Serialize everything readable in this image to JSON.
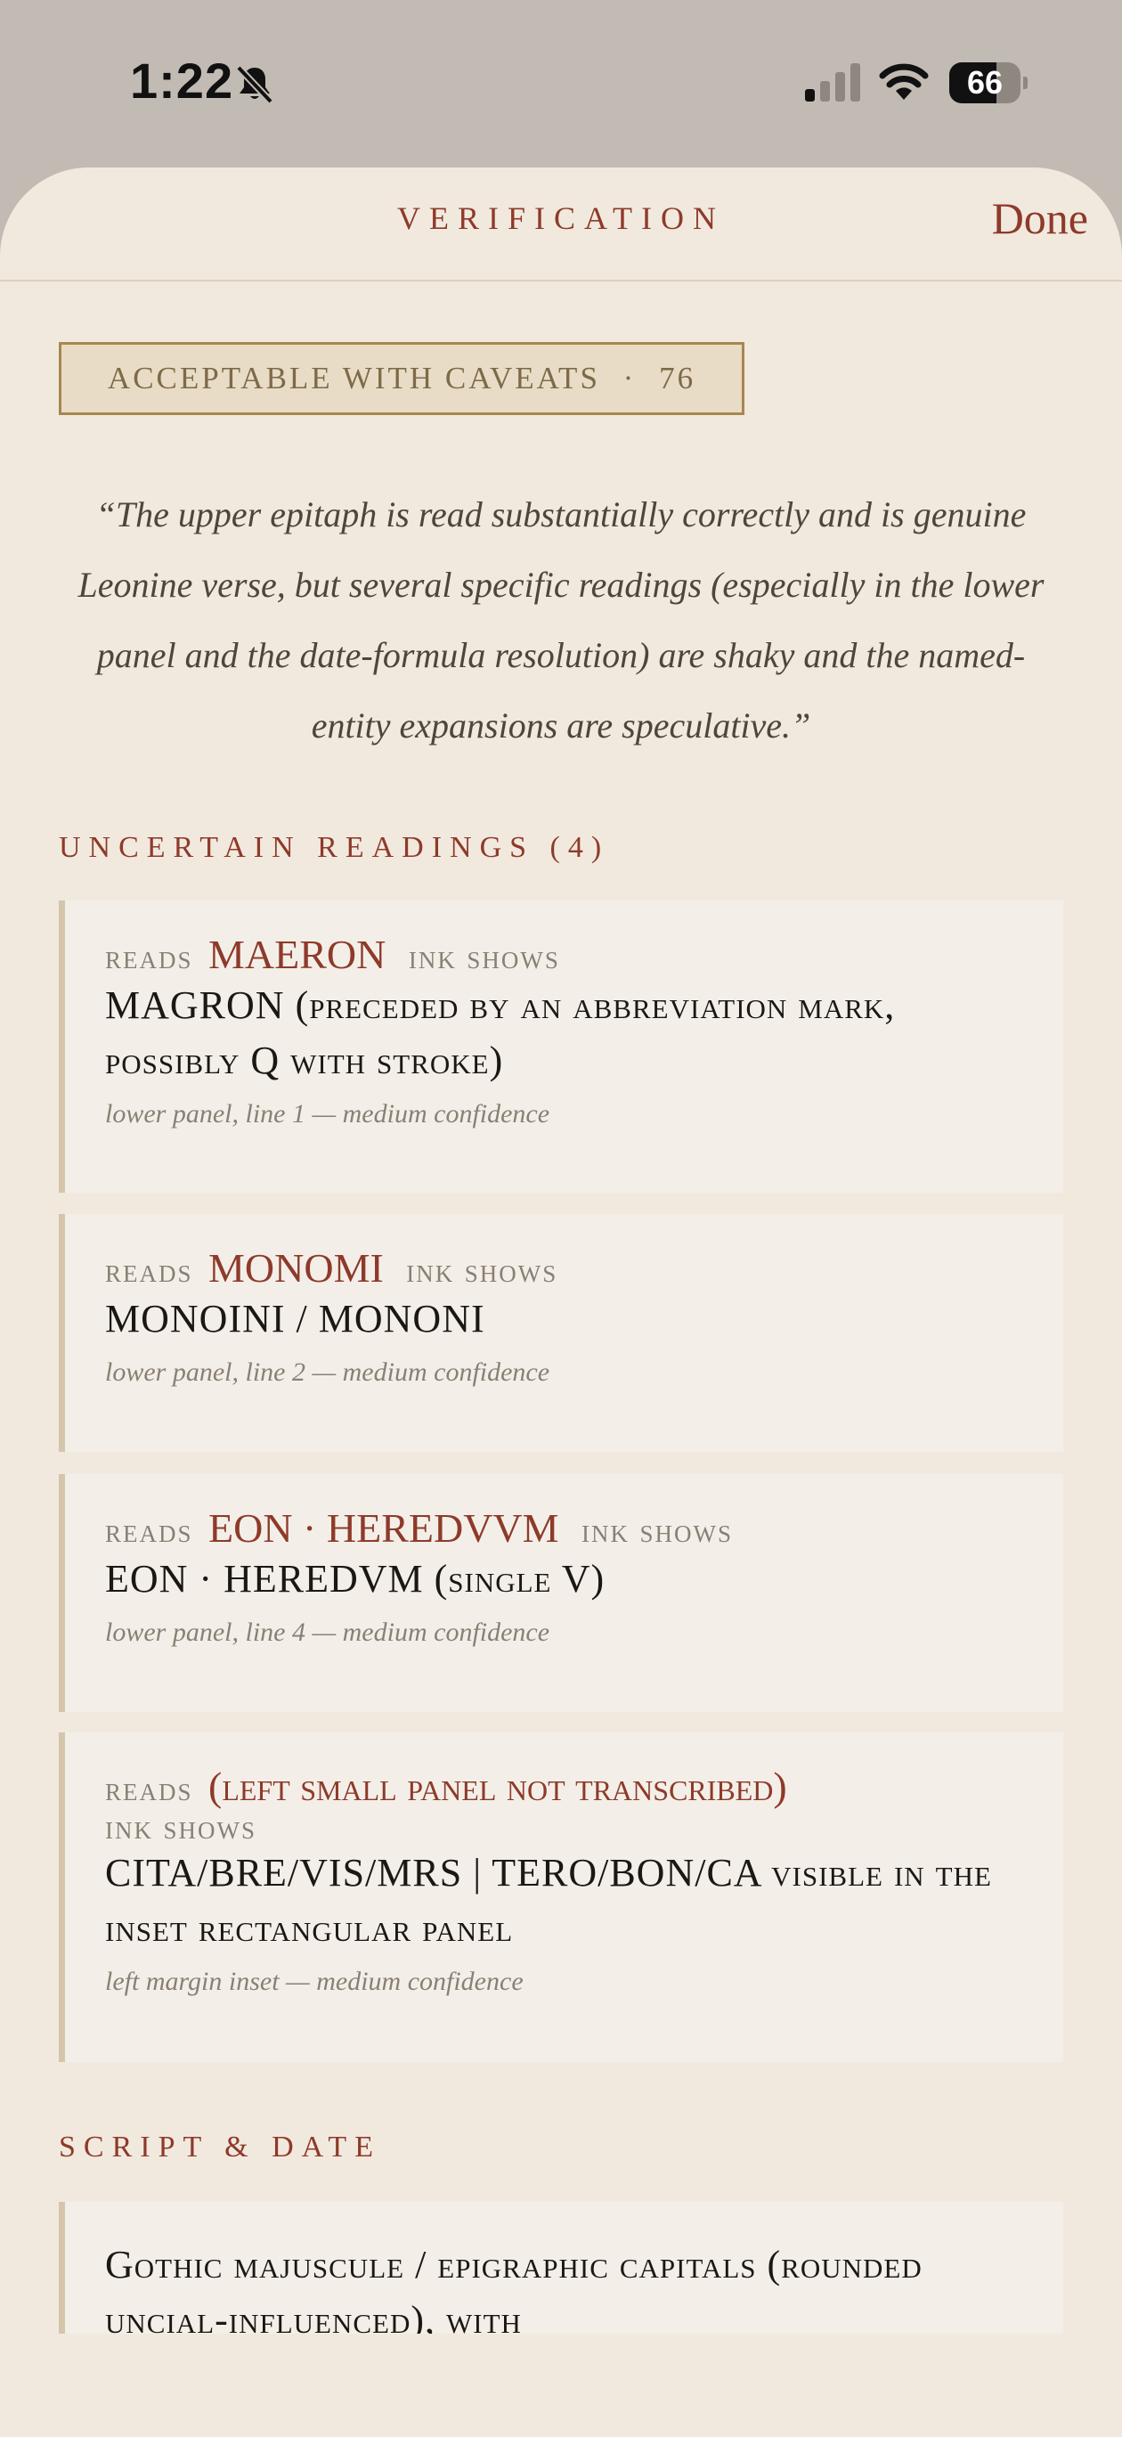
{
  "status_bar": {
    "time": "1:22",
    "battery_level": "66",
    "battery_fraction": 0.66,
    "signal_bars_active": 1,
    "signal_bars_total": 4
  },
  "sheet": {
    "title": "VERIFICATION",
    "done_label": "Done"
  },
  "verdict": {
    "label": "ACCEPTABLE WITH CAVEATS",
    "separator": "·",
    "score": "76"
  },
  "summary_quote": "“The upper epitaph is read substantially correctly and is genuine Leonine verse, but several specific readings (especially in the lower panel and the date-formula resolution) are shaky and the named-entity expansions are speculative.”",
  "uncertain_readings": {
    "heading": "UNCERTAIN READINGS (4)",
    "reads_label": "reads",
    "ink_label": "ink shows",
    "items": [
      {
        "reads": "MAERON",
        "ink_shows": "MAGRON (preceded by an abbreviation mark, possibly Q with stroke)",
        "meta": "lower panel, line 1 — medium confidence"
      },
      {
        "reads": "MONOMI",
        "ink_shows": "MONOINI / MONONI",
        "meta": "lower panel, line 2 — medium confidence"
      },
      {
        "reads": "EON · HEREDVVM",
        "ink_shows": "EON · HEREDVM (single V)",
        "meta": "lower panel, line 4 — medium confidence"
      },
      {
        "reads": "(left small panel not transcribed)",
        "ink_shows": "CITA/BRE/VIS/MRS | TERO/BON/CA visible in the inset rectangular panel",
        "meta": "left margin inset — medium confidence"
      }
    ]
  },
  "script_date": {
    "heading": "SCRIPT & DATE",
    "text": "Gothic majuscule / epigraphic capitals (rounded uncial-influenced), with"
  },
  "colors": {
    "accent": "#8e3a2a",
    "sheet_bg": "#f1e9de",
    "card_bg": "#f3efe8",
    "badge_border": "#a8874f"
  }
}
